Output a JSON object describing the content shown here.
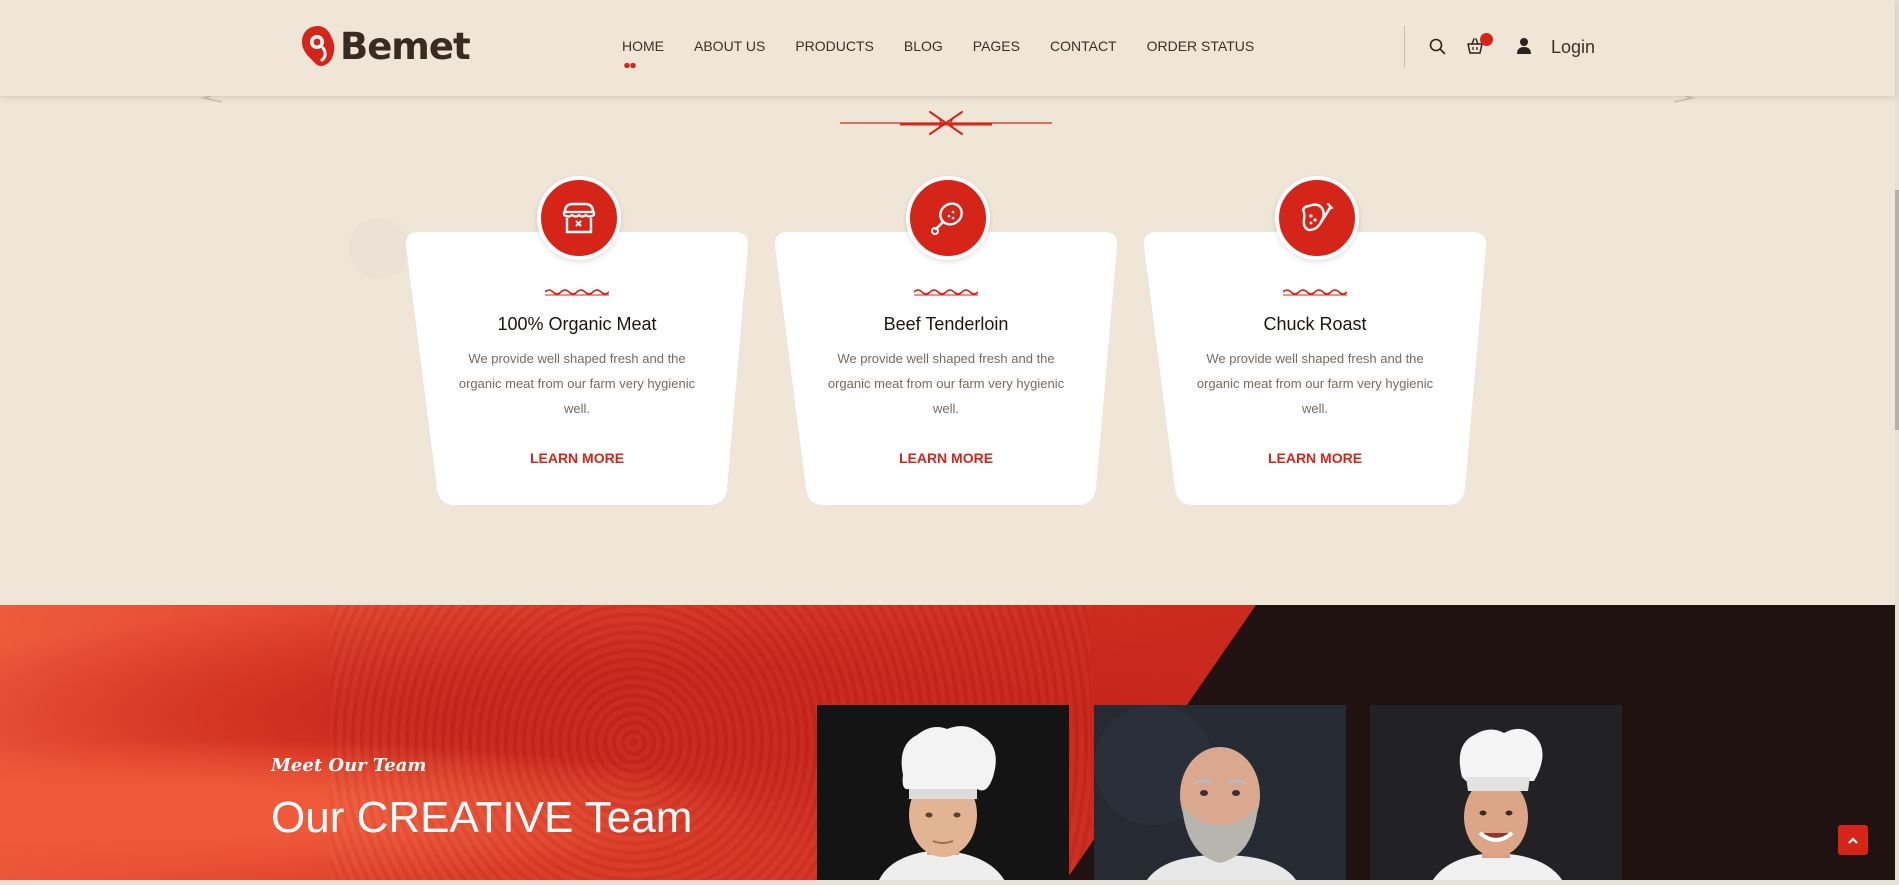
{
  "brand": {
    "name": "Bemet",
    "accent": "#d52518",
    "dark": "#3a2a22",
    "bg": "#efe6d8"
  },
  "nav": {
    "items": [
      {
        "label": "HOME",
        "active": true
      },
      {
        "label": "ABOUT US",
        "active": false
      },
      {
        "label": "PRODUCTS",
        "active": false
      },
      {
        "label": "BLOG",
        "active": false
      },
      {
        "label": "PAGES",
        "active": false
      },
      {
        "label": "CONTACT",
        "active": false
      },
      {
        "label": "ORDER STATUS",
        "active": false
      }
    ],
    "icons": [
      "search-icon",
      "cart-icon",
      "user-icon"
    ],
    "login_label": "Login"
  },
  "features": {
    "cards": [
      {
        "icon": "shop-icon",
        "title": "100% Organic Meat",
        "description": "We provide well shaped fresh and the organic meat from our farm very hygienic well.",
        "link": "LEARN MORE"
      },
      {
        "icon": "chicken-leg-icon",
        "title": "Beef Tenderloin",
        "description": "We provide well shaped fresh and the organic meat from our farm very hygienic well.",
        "link": "LEARN MORE"
      },
      {
        "icon": "steak-icon",
        "title": "Chuck Roast",
        "description": "We provide well shaped fresh and the organic meat from our farm very hygienic well.",
        "link": "LEARN MORE"
      }
    ]
  },
  "team": {
    "subtitle": "Meet Our Team",
    "title": "Our CREATIVE Team",
    "members": [
      "chef-photo",
      "chef-photo",
      "chef-photo"
    ]
  },
  "scroll_top_icon": "chevron-up-icon"
}
